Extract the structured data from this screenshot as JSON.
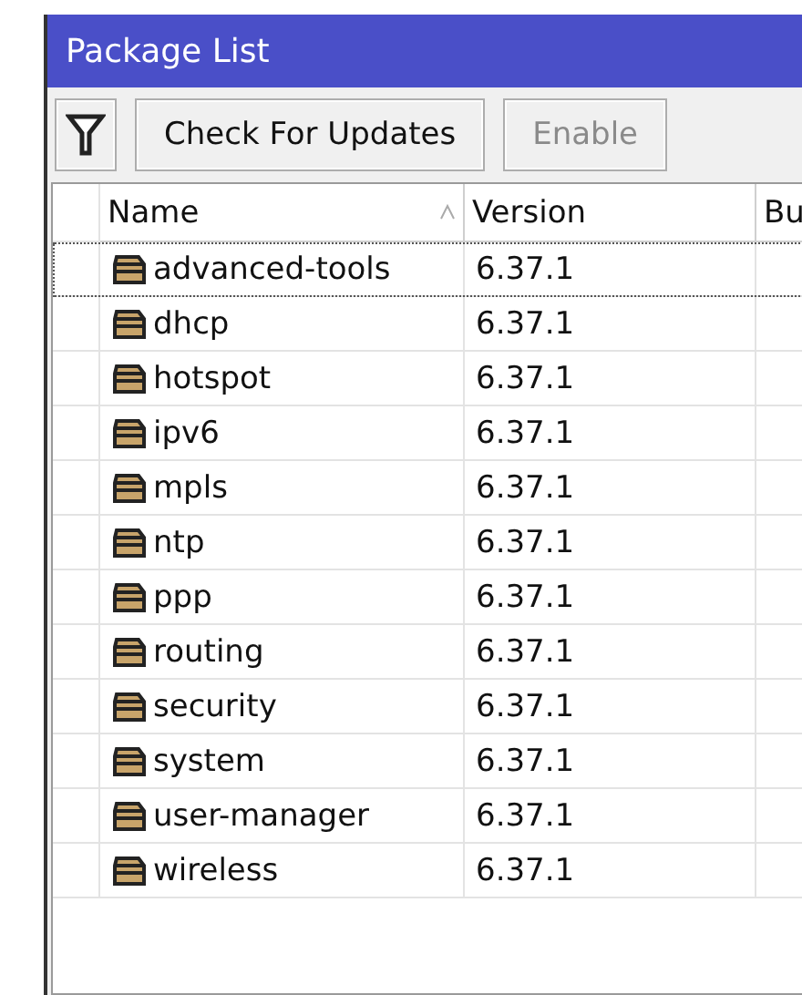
{
  "window": {
    "title": "Package List"
  },
  "toolbar": {
    "buttons": [
      {
        "kind": "filter"
      },
      {
        "kind": "text",
        "label": "Check For Updates",
        "disabled": false
      },
      {
        "kind": "text",
        "label": "Enable",
        "disabled": true
      }
    ]
  },
  "table": {
    "columns": [
      "Name",
      "Version",
      "Bu"
    ],
    "rows": [
      {
        "name": "advanced-tools",
        "version": "6.37.1",
        "selected": true
      },
      {
        "name": "dhcp",
        "version": "6.37.1",
        "selected": false
      },
      {
        "name": "hotspot",
        "version": "6.37.1",
        "selected": false
      },
      {
        "name": "ipv6",
        "version": "6.37.1",
        "selected": false
      },
      {
        "name": "mpls",
        "version": "6.37.1",
        "selected": false
      },
      {
        "name": "ntp",
        "version": "6.37.1",
        "selected": false
      },
      {
        "name": "ppp",
        "version": "6.37.1",
        "selected": false
      },
      {
        "name": "routing",
        "version": "6.37.1",
        "selected": false
      },
      {
        "name": "security",
        "version": "6.37.1",
        "selected": false
      },
      {
        "name": "system",
        "version": "6.37.1",
        "selected": false
      },
      {
        "name": "user-manager",
        "version": "6.37.1",
        "selected": false
      },
      {
        "name": "wireless",
        "version": "6.37.1",
        "selected": false
      }
    ]
  }
}
